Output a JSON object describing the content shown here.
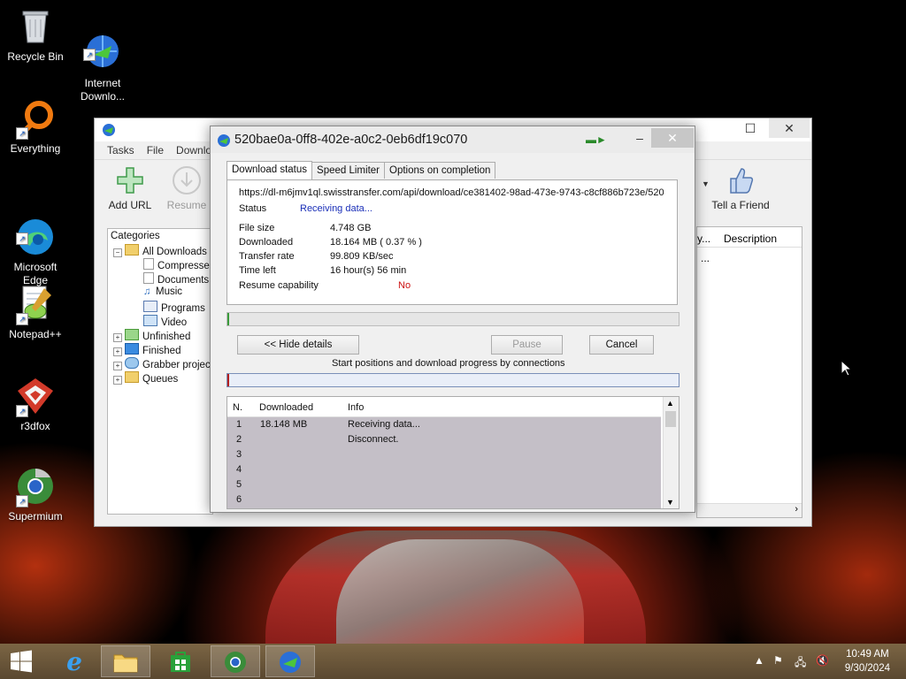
{
  "desktop": {
    "icons": [
      {
        "label": "Recycle Bin"
      },
      {
        "label": "Internet\nDownlo..."
      },
      {
        "label": "Everything"
      },
      {
        "label": "Microsoft\nEdge"
      },
      {
        "label": "Notepad++"
      },
      {
        "label": "r3dfox"
      },
      {
        "label": "Supermium"
      }
    ]
  },
  "main_window": {
    "menu": [
      "Tasks",
      "File",
      "Downlo"
    ],
    "toolbar": {
      "add_url": "Add URL",
      "resume": "Resume",
      "tell_friend": "Tell a Friend"
    },
    "categories_header": "Categories",
    "categories": [
      "All Downloads",
      "Compresse",
      "Documents",
      "Music",
      "Programs",
      "Video",
      "Unfinished",
      "Finished",
      "Grabber projec",
      "Queues"
    ],
    "columns": {
      "partial": "y...",
      "description": "Description"
    },
    "row_partial": "..."
  },
  "dialog": {
    "title": "520bae0a-0ff8-402e-a0c2-0eb6df19c070",
    "tabs": [
      "Download status",
      "Speed Limiter",
      "Options on completion"
    ],
    "url": "https://dl-m6jmv1ql.swisstransfer.com/api/download/ce381402-98ad-473e-9743-c8cf886b723e/520",
    "status_label": "Status",
    "status_value": "Receiving data...",
    "file_size_label": "File size",
    "file_size_value": "4.748  GB",
    "downloaded_label": "Downloaded",
    "downloaded_value": "18.164  MB  ( 0.37 % )",
    "transfer_rate_label": "Transfer rate",
    "transfer_rate_value": "99.809  KB/sec",
    "time_left_label": "Time left",
    "time_left_value": "16 hour(s) 56 min",
    "resume_label": "Resume capability",
    "resume_value": "No",
    "progress_fraction": 0.0037,
    "hide_details": "<< Hide details",
    "pause": "Pause",
    "cancel": "Cancel",
    "connections_caption": "Start positions and download progress by connections",
    "grid_headers": {
      "n": "N.",
      "downloaded": "Downloaded",
      "info": "Info"
    },
    "grid_rows": [
      {
        "n": "1",
        "downloaded": "18.148  MB",
        "info": "Receiving data..."
      },
      {
        "n": "2",
        "downloaded": "",
        "info": "Disconnect."
      },
      {
        "n": "3",
        "downloaded": "",
        "info": ""
      },
      {
        "n": "4",
        "downloaded": "",
        "info": ""
      },
      {
        "n": "5",
        "downloaded": "",
        "info": ""
      },
      {
        "n": "6",
        "downloaded": "",
        "info": ""
      }
    ]
  },
  "taskbar": {
    "time": "10:49 AM",
    "date": "9/30/2024"
  },
  "colors": {
    "status_blue": "#1a2fb8",
    "resume_red": "#cc1111",
    "taskbar": "#6e5a3e"
  }
}
